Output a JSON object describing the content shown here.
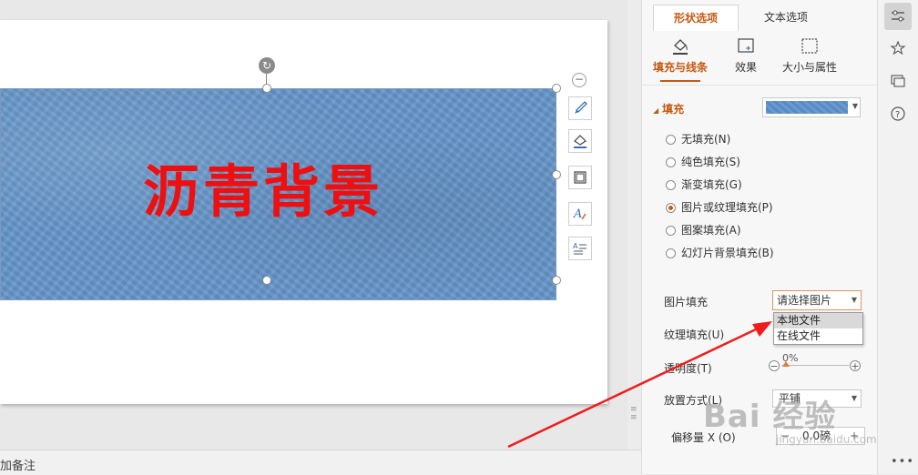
{
  "slide": {
    "shape_text": "沥青背景",
    "shape_color": "#6494c8",
    "text_color": "#ee1010"
  },
  "float_tools": [
    "collapse-icon",
    "brush-icon",
    "fill-bucket-icon",
    "outline-icon",
    "text-style-icon",
    "text-wrap-icon"
  ],
  "status_bar": {
    "notes_label": "加备注"
  },
  "pane": {
    "tabs": [
      {
        "label": "形状选项",
        "active": true
      },
      {
        "label": "文本选项",
        "active": false
      }
    ],
    "subtabs": [
      {
        "label": "填充与线条",
        "icon": "fill-line-icon",
        "active": true
      },
      {
        "label": "效果",
        "icon": "effects-icon",
        "active": false
      },
      {
        "label": "大小与属性",
        "icon": "size-props-icon",
        "active": false
      }
    ],
    "fill_heading": "填充",
    "fill_options": [
      {
        "label": "无填充(N)",
        "checked": false
      },
      {
        "label": "纯色填充(S)",
        "checked": false
      },
      {
        "label": "渐变填充(G)",
        "checked": false
      },
      {
        "label": "图片或纹理填充(P)",
        "checked": true
      },
      {
        "label": "图案填充(A)",
        "checked": false
      },
      {
        "label": "幻灯片背景填充(B)",
        "checked": false
      }
    ],
    "picture_fill_label": "图片填充",
    "picture_fill_value": "请选择图片",
    "picture_fill_options": [
      "本地文件",
      "在线文件"
    ],
    "texture_fill_label": "纹理填充(U)",
    "transparency_label": "透明度(T)",
    "transparency_value": "0%",
    "placement_label": "放置方式(L)",
    "placement_value": "平铺",
    "offset_x_label": "偏移量 X (O)",
    "offset_x_value": "0.0磅",
    "accent_color": "#c45911"
  },
  "rail": [
    "properties-icon",
    "star-icon",
    "slides-icon",
    "help-icon",
    "more-icon"
  ],
  "watermark": {
    "main": "Bai 经验",
    "sub": "jingyan.baidu.com"
  }
}
